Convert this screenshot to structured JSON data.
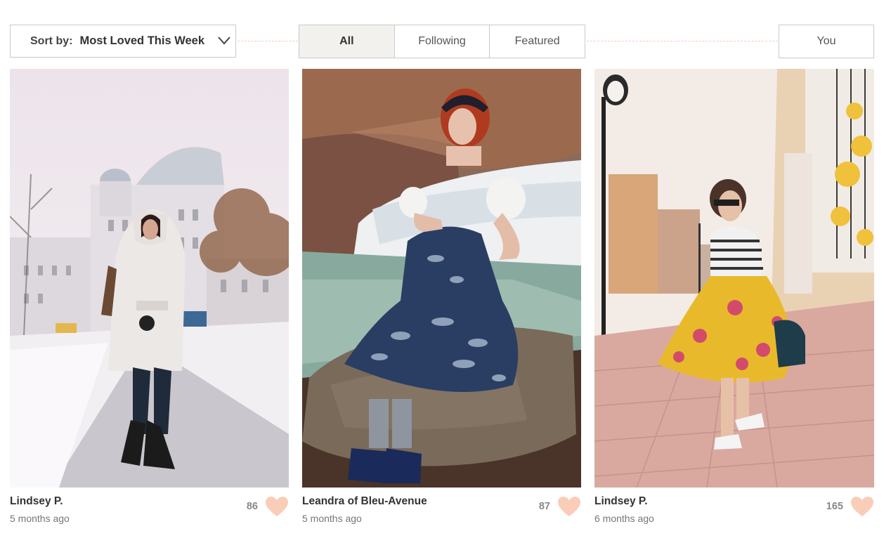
{
  "toolbar": {
    "sort_prefix": "Sort by:",
    "sort_value": "Most Loved This Week",
    "tabs": [
      {
        "label": "All",
        "active": true
      },
      {
        "label": "Following",
        "active": false
      },
      {
        "label": "Featured",
        "active": false
      }
    ],
    "you_label": "You"
  },
  "posts": [
    {
      "author": "Lindsey P.",
      "time": "5 months ago",
      "likes": "86"
    },
    {
      "author": "Leandra of Bleu-Avenue",
      "time": "5 months ago",
      "likes": "87"
    },
    {
      "author": "Lindsey P.",
      "time": "6 months ago",
      "likes": "165"
    }
  ],
  "colors": {
    "heart": "#f9cdb8",
    "divider": "#f1cdb9",
    "active_tab_bg": "#f3f1ee"
  }
}
